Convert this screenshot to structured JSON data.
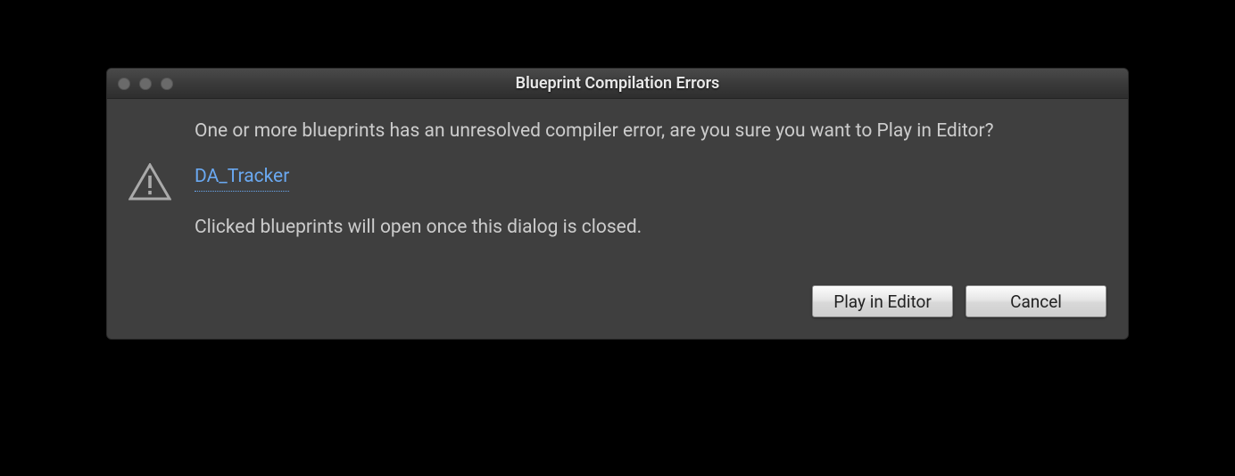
{
  "dialog": {
    "title": "Blueprint Compilation Errors",
    "message_primary": "One or more blueprints has an unresolved compiler error, are you sure you want to Play in Editor?",
    "blueprint_link": "DA_Tracker",
    "message_secondary": "Clicked blueprints will open once this dialog is closed.",
    "buttons": {
      "play": "Play in Editor",
      "cancel": "Cancel"
    }
  }
}
